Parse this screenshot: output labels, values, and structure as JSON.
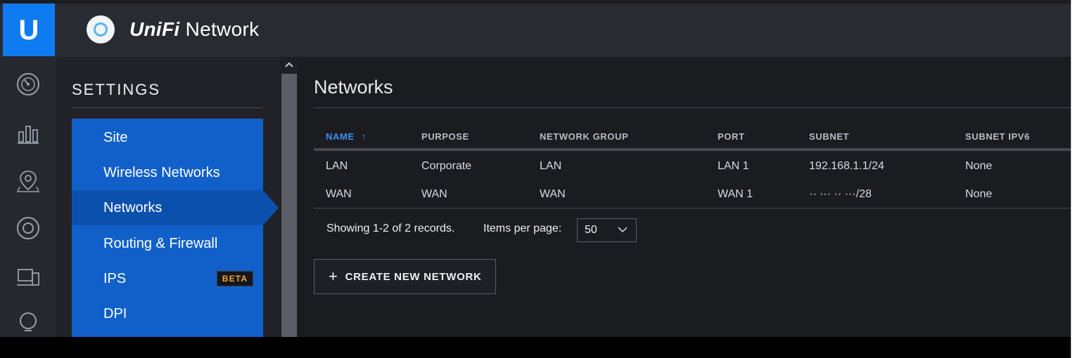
{
  "app": {
    "brand_letter": "U",
    "title_prefix": "UniFi",
    "title_suffix": " Network"
  },
  "rail": {
    "icons": [
      "dashboard-gauge-icon",
      "statistics-bars-icon",
      "map-pin-icon",
      "devices-circle-icon",
      "clients-monitor-icon",
      "insights-bulb-icon"
    ]
  },
  "settings": {
    "heading": "SETTINGS",
    "menu": [
      {
        "label": "Site",
        "active": false
      },
      {
        "label": "Wireless Networks",
        "active": false
      },
      {
        "label": "Networks",
        "active": true
      },
      {
        "label": "Routing & Firewall",
        "active": false
      },
      {
        "label": "IPS",
        "active": false,
        "badge": "BETA"
      },
      {
        "label": "DPI",
        "active": false
      }
    ]
  },
  "page": {
    "title": "Networks"
  },
  "table": {
    "columns": [
      {
        "label": "NAME",
        "sort_indicator": "↑",
        "sorted": true
      },
      {
        "label": "PURPOSE"
      },
      {
        "label": "NETWORK GROUP"
      },
      {
        "label": "PORT"
      },
      {
        "label": "SUBNET"
      },
      {
        "label": "SUBNET IPV6"
      }
    ],
    "rows": [
      {
        "name": "LAN",
        "purpose": "Corporate",
        "network_group": "LAN",
        "port": "LAN 1",
        "subnet": "192.168.1.1/24",
        "subnet_ipv6": "None"
      },
      {
        "name": "WAN",
        "purpose": "WAN",
        "network_group": "WAN",
        "port": "WAN 1",
        "subnet": "·· ··· ·· ···/28",
        "subnet_ipv6": "None"
      }
    ]
  },
  "pagination": {
    "records_text": "Showing 1-2 of 2 records.",
    "items_per_page_label": "Items per page:",
    "items_per_page_value": "50"
  },
  "actions": {
    "create_label": "CREATE NEW NETWORK"
  },
  "colors": {
    "brand_blue": "#0e7cf0",
    "menu_blue": "#1160c9",
    "menu_active": "#0c50ad",
    "sort_blue": "#3d8ef5",
    "beta_orange": "#f4a734"
  }
}
